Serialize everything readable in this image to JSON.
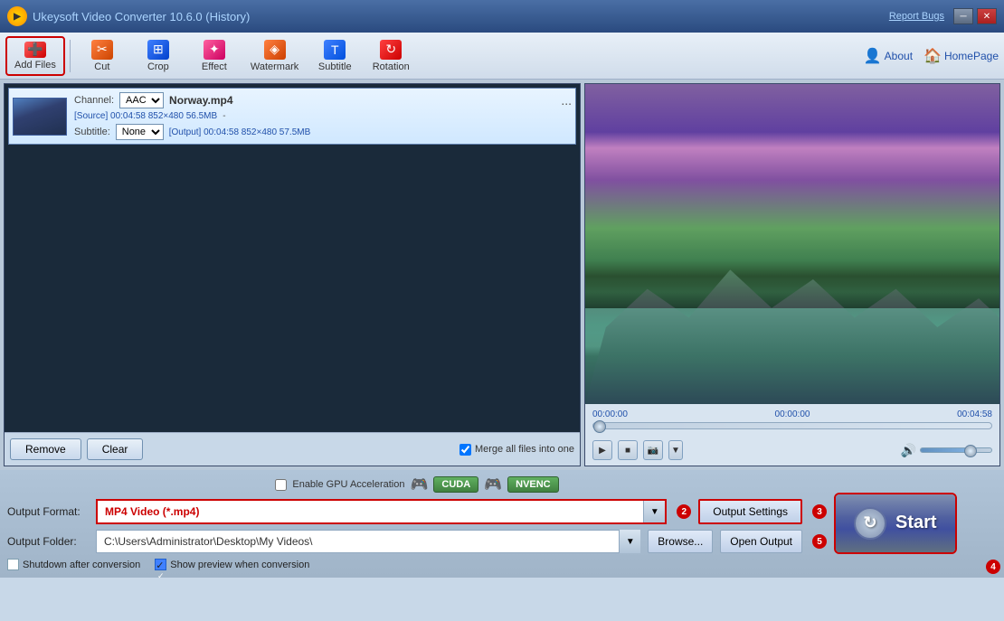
{
  "window": {
    "title": "Ukeysoft Video Converter 10.6.0",
    "history": "(History)",
    "report_bugs": "Report Bugs",
    "minimize": "─",
    "close": "✕"
  },
  "toolbar": {
    "add_files": "Add Files",
    "cut": "Cut",
    "crop": "Crop",
    "effect": "Effect",
    "watermark": "Watermark",
    "subtitle": "Subtitle",
    "rotation": "Rotation",
    "about": "About",
    "homepage": "HomePage"
  },
  "file_item": {
    "channel_label": "Channel:",
    "channel_value": "AAC",
    "subtitle_label": "Subtitle:",
    "subtitle_value": "None",
    "filename": "Norway.mp4",
    "source_info": "[Source]  00:04:58  852×480  56.5MB",
    "output_info": "[Output]  00:04:58  852×480  57.5MB",
    "more": "..."
  },
  "file_buttons": {
    "remove": "Remove",
    "clear": "Clear",
    "merge_label": "Merge all files into one"
  },
  "preview": {
    "time_start": "00:00:00",
    "time_middle": "00:00:00",
    "time_end": "00:04:58"
  },
  "settings": {
    "gpu_label": "Enable GPU Acceleration",
    "cuda": "CUDA",
    "nvenc": "NVENC",
    "output_format_label": "Output Format:",
    "output_format_value": "MP4 Video (*.mp4)",
    "output_settings_btn": "Output Settings",
    "badge_2": "2",
    "output_folder_label": "Output Folder:",
    "output_folder_value": "C:\\Users\\Administrator\\Desktop\\My Videos\\",
    "browse_btn": "Browse...",
    "open_output_btn": "Open Output",
    "badge_5": "5",
    "shutdown_label": "Shutdown after conversion",
    "show_preview_label": "Show preview when conversion",
    "start_btn": "Start",
    "badge_3": "3",
    "badge_4": "4"
  }
}
